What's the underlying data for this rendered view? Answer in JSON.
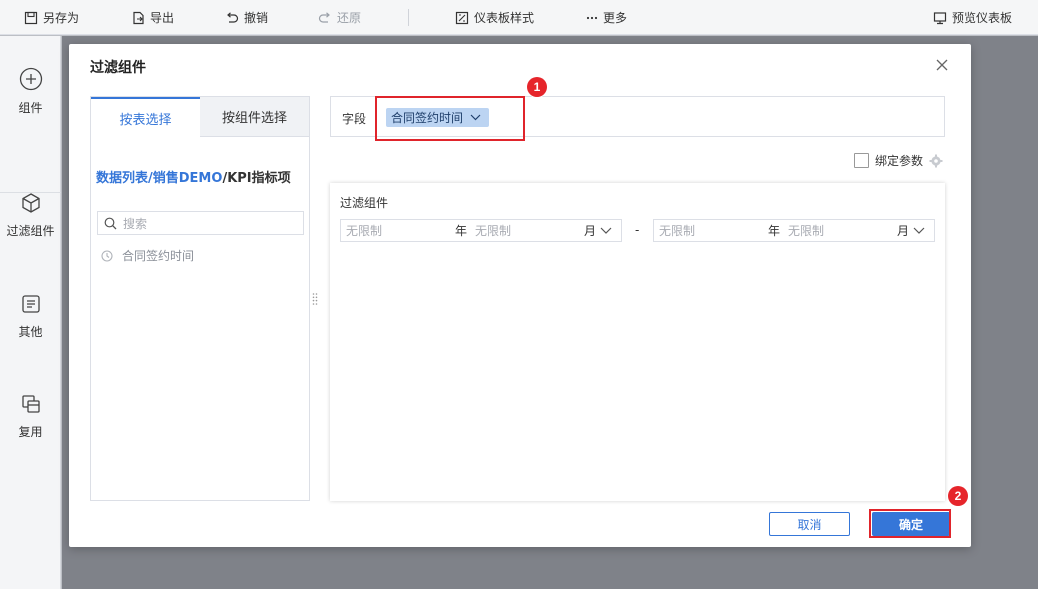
{
  "toolbar": {
    "save_as": "另存为",
    "export": "导出",
    "undo": "撤销",
    "redo": "还原",
    "dashboard_style": "仪表板样式",
    "more": "更多",
    "preview": "预览仪表板"
  },
  "sidebar": {
    "items": [
      {
        "label": "组件",
        "icon": "plus-circle-icon"
      },
      {
        "label": "过滤组件",
        "icon": "cube-icon"
      },
      {
        "label": "其他",
        "icon": "text-box-icon"
      },
      {
        "label": "复用",
        "icon": "stack-icon"
      }
    ]
  },
  "dialog": {
    "title": "过滤组件",
    "tabs": [
      "按表选择",
      "按组件选择"
    ],
    "breadcrumb": {
      "part1": "数据列表",
      "sep1": "/",
      "part2": "销售DEMO",
      "sep2": "/",
      "part3": "KPI指标项"
    },
    "search_placeholder": "搜索",
    "field_item": "合同签约时间",
    "field_label": "字段",
    "selected_field": "合同签约时间",
    "bind_param": "绑定参数",
    "preview_title": "过滤组件",
    "range": {
      "start_year_ph": "无限制",
      "start_year_unit": "年",
      "start_month_ph": "无限制",
      "start_month_unit": "月",
      "dash": "-",
      "end_year_ph": "无限制",
      "end_year_unit": "年",
      "end_month_ph": "无限制",
      "end_month_unit": "月"
    },
    "cancel": "取消",
    "ok": "确定"
  },
  "annotations": {
    "badge1": "1",
    "badge2": "2"
  },
  "colors": {
    "accent": "#3576d8",
    "highlight": "#e0242b",
    "tag_bg": "#bcd4f2"
  }
}
